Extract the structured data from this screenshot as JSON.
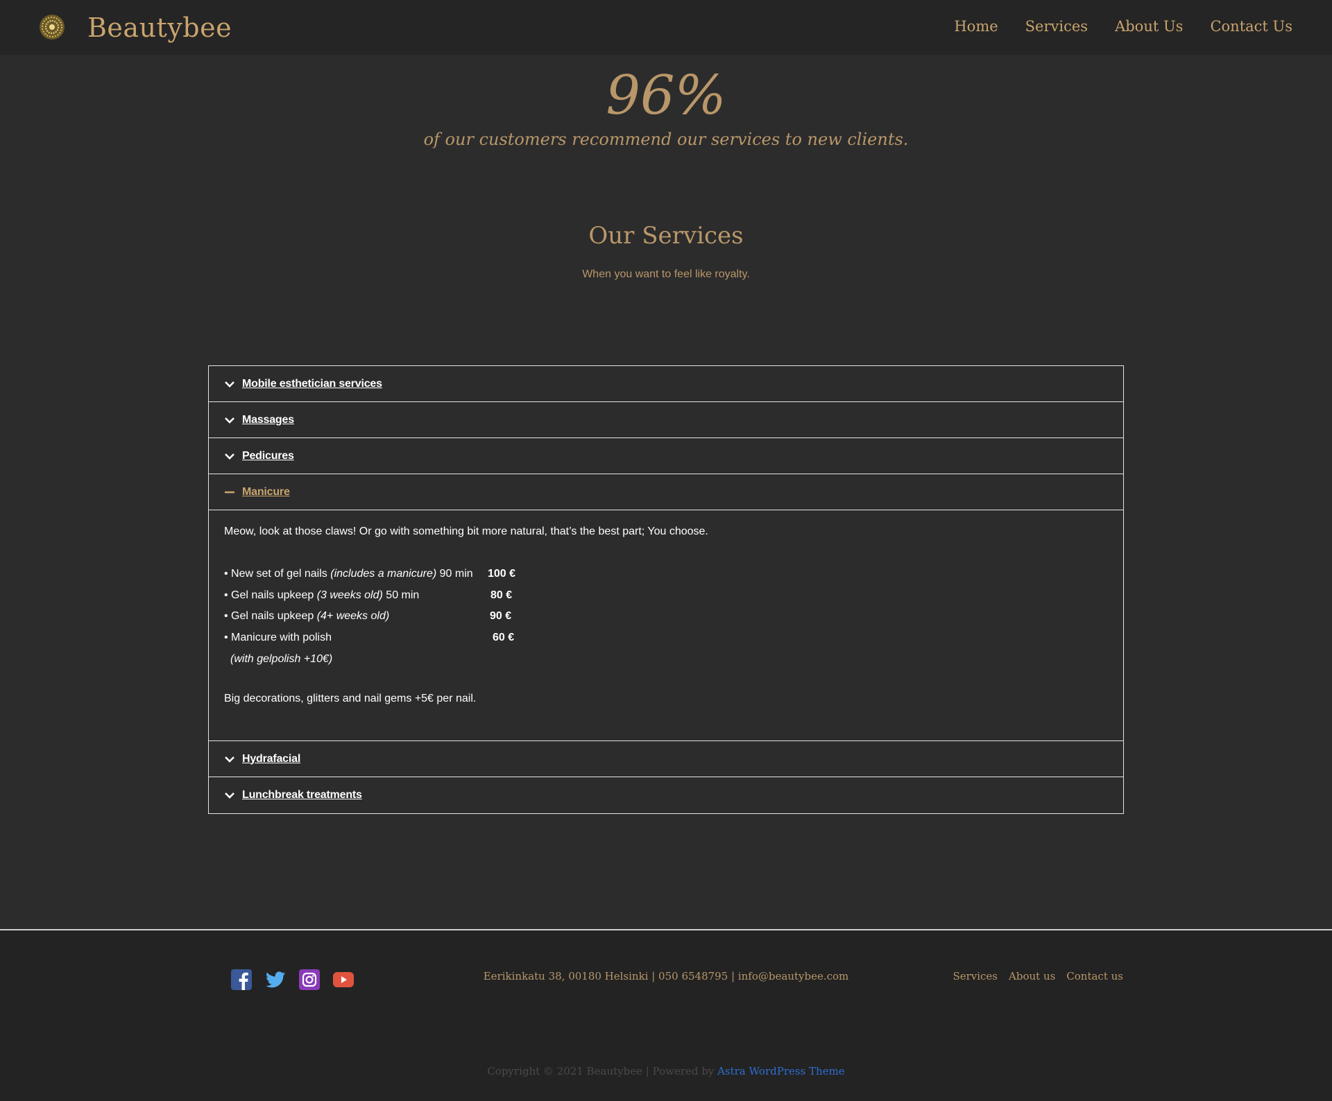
{
  "header": {
    "site_title": "Beautybee",
    "logo_icon": "mandala-logo-icon",
    "nav": [
      "Home",
      "Services",
      "About Us",
      "Contact Us"
    ]
  },
  "stats": {
    "value": "96%",
    "caption": "of our customers recommend our services to new clients."
  },
  "services": {
    "title": "Our Services",
    "subtitle": "When you want to feel like royalty.",
    "accordion": [
      {
        "label": "Mobile esthetician services",
        "expanded": false
      },
      {
        "label": "Massages",
        "expanded": false
      },
      {
        "label": "Pedicures",
        "expanded": false
      },
      {
        "label": "Manicure",
        "expanded": true
      },
      {
        "label": "Hydrafacial",
        "expanded": false
      },
      {
        "label": "Lunchbreak treatments",
        "expanded": false
      }
    ],
    "manicure": {
      "intro": "Meow, look at those claws! Or go with something bit more natural, that’s the best part; You choose.",
      "items": [
        {
          "pre": "• New set of gel nails ",
          "em": "(includes a manicure)",
          "post": " 90 min",
          "price": "100 €"
        },
        {
          "pre": "• Gel nails upkeep ",
          "em": "(3 weeks old)",
          "post": " 50 min",
          "price": "80 €"
        },
        {
          "pre": "• Gel nails upkeep ",
          "em": "(4+ weeks old)",
          "post": "",
          "price": "90 €"
        },
        {
          "pre": "• Manicure with polish",
          "em": "",
          "post": "",
          "price": "60 €"
        }
      ],
      "note": "(with gelpolish +10€)",
      "extra": "Big decorations, glitters and nail gems +5€ per nail."
    }
  },
  "footer": {
    "social": [
      "facebook-icon",
      "twitter-icon",
      "instagram-icon",
      "youtube-icon"
    ],
    "contact": "Eerikinkatu 38, 00180 Helsinki | 050 6548795 | info@beautybee.com",
    "links": [
      "Services",
      "About us",
      "Contact us"
    ],
    "copyright_prefix": "Copyright © 2021 Beautybee | Powered by ",
    "copyright_link": "Astra WordPress Theme"
  },
  "colors": {
    "accent": "#c9a46e",
    "background": "#2c2c2c",
    "header_bg": "#252525"
  }
}
